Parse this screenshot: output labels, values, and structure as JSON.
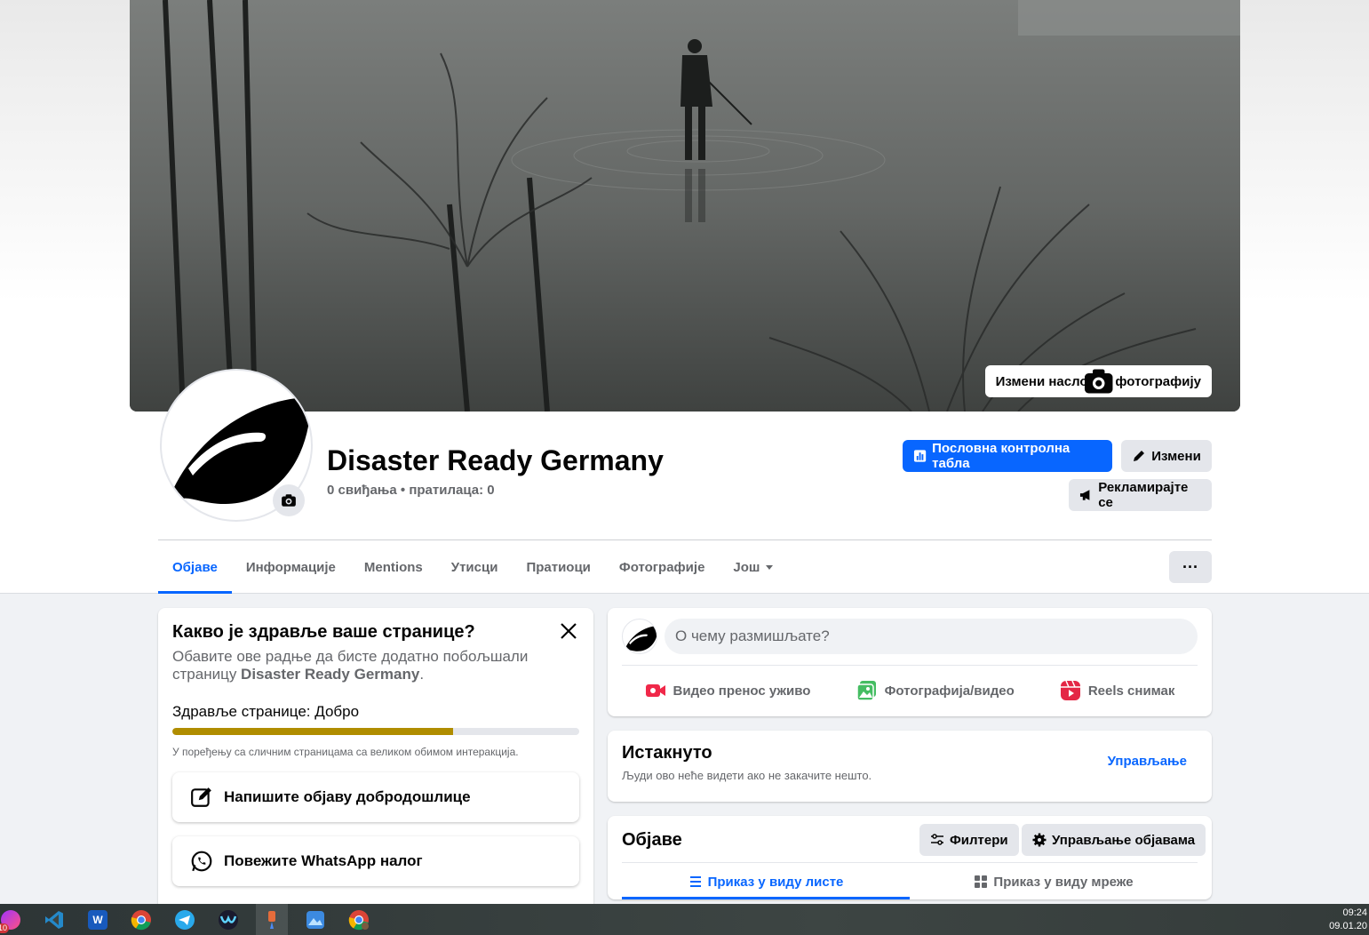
{
  "cover": {
    "edit_cover_label": "Измени насловну фотографију"
  },
  "profile": {
    "name": "Disaster Ready Germany",
    "stats": "0 свиђања • пратилаца: 0"
  },
  "header_buttons": {
    "dashboard_label": "Пословна контролна табла",
    "edit_label": "Измени",
    "promote_label": "Рекламирајте се"
  },
  "tabs": [
    {
      "label": "Објаве",
      "active": true
    },
    {
      "label": "Информације"
    },
    {
      "label": "Mentions"
    },
    {
      "label": "Утисци"
    },
    {
      "label": "Пратиоци"
    },
    {
      "label": "Фотографије"
    },
    {
      "label": "Још"
    }
  ],
  "more_menu_label": "···",
  "health": {
    "title": "Какво је здравље ваше странице?",
    "desc_prefix": "Обавите ове радње да бисте додатно побољшали страницу ",
    "desc_page": "Disaster Ready Germany",
    "desc_suffix": ".",
    "status": "Здравље странице: Добро",
    "progress": 0.69,
    "progress_color": "#b08d00",
    "note": "У поређењу са сличним страницама са великом обимом интеракција.",
    "actions": [
      {
        "label": "Напишите објаву добродошлице",
        "icon": "edit-post-icon"
      },
      {
        "label": "Повежите WhatsApp налог",
        "icon": "whatsapp-icon"
      }
    ]
  },
  "composer": {
    "placeholder": "О чему размишљате?",
    "actions": [
      {
        "label": "Видео пренос уживо",
        "icon": "live-video-icon",
        "color": "#f02849"
      },
      {
        "label": "Фотографија/видео",
        "icon": "photo-video-icon",
        "color": "#45bd62"
      },
      {
        "label": "Reels снимак",
        "icon": "reels-icon",
        "color": "#e42645"
      }
    ]
  },
  "featured": {
    "title": "Истакнуто",
    "subtitle": "Људи ово неће видети ако не закачите нешто.",
    "manage_label": "Управљање"
  },
  "posts": {
    "title": "Објаве",
    "filters_label": "Филтери",
    "manage_label": "Управљање објавама",
    "list_view_label": "Приказ у виду листе",
    "grid_view_label": "Приказ у виду мреже"
  },
  "taskbar": {
    "badge": "10",
    "time": "09:24",
    "date": "09.01.20"
  },
  "colors": {
    "accent": "#0866ff",
    "secondary_text": "#65676b",
    "button_gray": "#e4e6eb"
  }
}
